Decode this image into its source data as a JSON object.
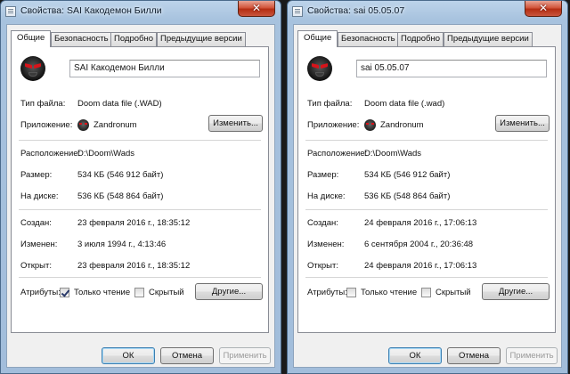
{
  "windows": [
    {
      "title": "Свойства: SAI Какодемон Билли",
      "close": "✕",
      "tabs": [
        "Общие",
        "Безопасность",
        "Подробно",
        "Предыдущие версии"
      ],
      "file_name": "SAI Какодемон Билли",
      "file_type_label": "Тип файла:",
      "file_type": "Doom data file (.WAD)",
      "app_label": "Приложение:",
      "app_name": "Zandronum",
      "change_button": "Изменить...",
      "location_label": "Расположение:",
      "location": "D:\\Doom\\Wads",
      "size_label": "Размер:",
      "size": "534 КБ (546 912 байт)",
      "disk_label": "На диске:",
      "disk": "536 КБ (548 864 байт)",
      "created_label": "Создан:",
      "created": "23 февраля 2016 г., 18:35:12",
      "modified_label": "Изменен:",
      "modified": "3 июля 1994 г., 4:13:46",
      "accessed_label": "Открыт:",
      "accessed": "23 февраля 2016 г., 18:35:12",
      "attributes_label": "Атрибуты:",
      "readonly_label": "Только чтение",
      "readonly_checked": true,
      "hidden_label": "Скрытый",
      "hidden_checked": false,
      "other_button": "Другие...",
      "ok_button": "ОК",
      "cancel_button": "Отмена",
      "apply_button": "Применить"
    },
    {
      "title": "Свойства: sai 05.05.07",
      "close": "✕",
      "tabs": [
        "Общие",
        "Безопасность",
        "Подробно",
        "Предыдущие версии"
      ],
      "file_name": "sai 05.05.07",
      "file_type_label": "Тип файла:",
      "file_type": "Doom data file (.wad)",
      "app_label": "Приложение:",
      "app_name": "Zandronum",
      "change_button": "Изменить...",
      "location_label": "Расположение:",
      "location": "D:\\Doom\\Wads",
      "size_label": "Размер:",
      "size": "534 КБ (546 912 байт)",
      "disk_label": "На диске:",
      "disk": "536 КБ (548 864 байт)",
      "created_label": "Создан:",
      "created": "24 февраля 2016 г., 17:06:13",
      "modified_label": "Изменен:",
      "modified": "6 сентября 2004 г., 20:36:48",
      "accessed_label": "Открыт:",
      "accessed": "24 февраля 2016 г., 17:06:13",
      "attributes_label": "Атрибуты:",
      "readonly_label": "Только чтение",
      "readonly_checked": false,
      "hidden_label": "Скрытый",
      "hidden_checked": false,
      "other_button": "Другие...",
      "ok_button": "ОК",
      "cancel_button": "Отмена",
      "apply_button": "Применить"
    }
  ]
}
